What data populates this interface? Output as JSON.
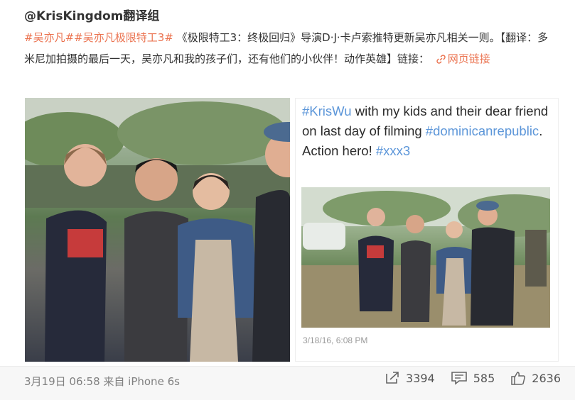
{
  "post": {
    "author": "@KrisKingdom翻译组",
    "tags": [
      "#吴亦凡#",
      "#吴亦凡极限特工3#"
    ],
    "body": "《极限特工3：终极回归》导演D·J·卡卢索推特更新吴亦凡相关一则。【翻译：多米尼加拍摄的最后一天，吴亦凡和我的孩子们，还有他们的小伙伴！动作英雄】链接：",
    "link_label": "网页链接"
  },
  "tweet": {
    "segments": [
      {
        "text": "#KrisWu",
        "hashtag": true
      },
      {
        "text": " with my kids and their dear friend on last day of filming ",
        "hashtag": false
      },
      {
        "text": "#dominicanrepublic",
        "hashtag": true
      },
      {
        "text": ". Action hero! ",
        "hashtag": false
      },
      {
        "text": "#xxx3",
        "hashtag": true
      }
    ],
    "timestamp": "3/18/16, 6:08 PM"
  },
  "footer": {
    "time_source": "3月19日 06:58 来自 iPhone 6s",
    "reposts": "3394",
    "comments": "585",
    "likes": "2636"
  },
  "colors": {
    "tag": "#eb7350",
    "tweet_hashtag": "#5c96d9"
  },
  "icons": [
    "link-icon",
    "repost-icon",
    "comment-icon",
    "like-icon"
  ]
}
